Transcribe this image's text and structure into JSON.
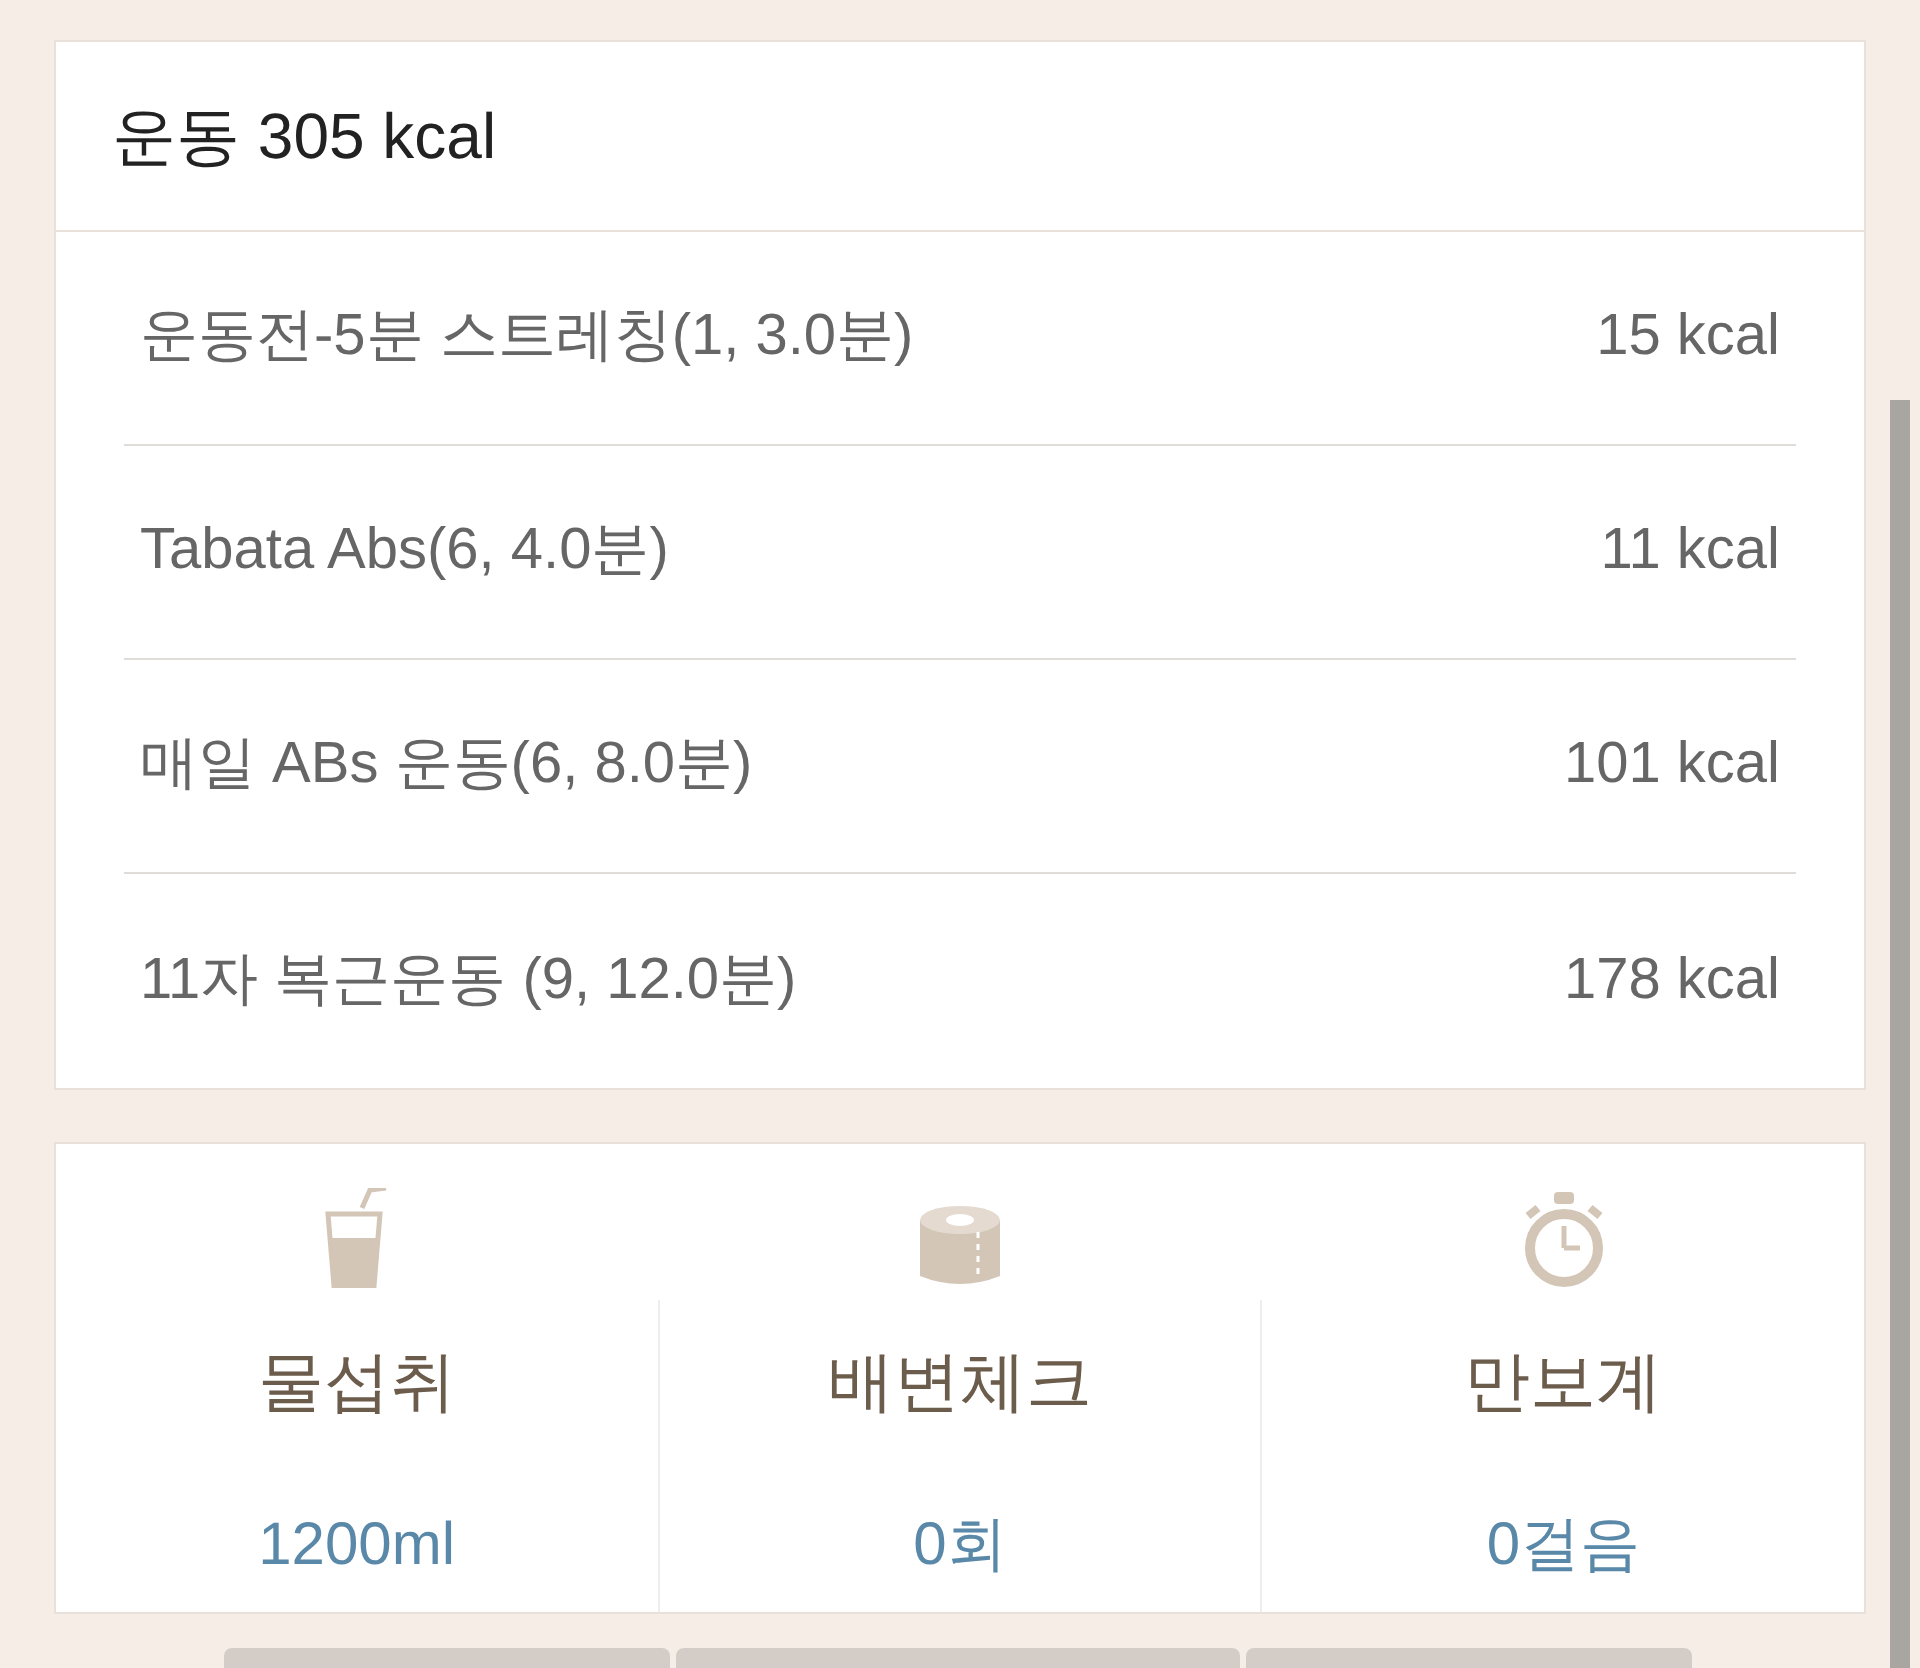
{
  "exercise": {
    "title": "운동 305 kcal",
    "items": [
      {
        "name": "운동전-5분 스트레칭(1, 3.0분)",
        "kcal": "15 kcal"
      },
      {
        "name": "Tabata Abs(6, 4.0분)",
        "kcal": "11 kcal"
      },
      {
        "name": "매일 ABs 운동(6, 8.0분)",
        "kcal": "101 kcal"
      },
      {
        "name": "11자 복근운동 (9, 12.0분)",
        "kcal": "178 kcal"
      }
    ]
  },
  "trackers": [
    {
      "kind": "water",
      "label": "물섭취",
      "value": "1200ml"
    },
    {
      "kind": "toilet",
      "label": "배변체크",
      "value": "0회"
    },
    {
      "kind": "steps",
      "label": "만보계",
      "value": "0걸음"
    }
  ]
}
